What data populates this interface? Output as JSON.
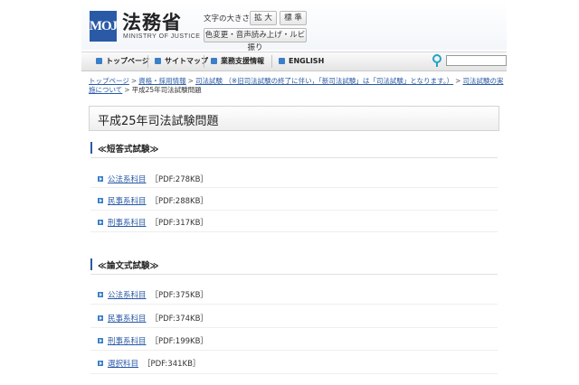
{
  "header": {
    "logo_mark": "MOJ",
    "logo_title": "法務省",
    "logo_sub": "MINISTRY OF JUSTICE",
    "textsize_label": "文字の大きさ",
    "btn_large": "拡 大",
    "btn_standard": "標 準",
    "btn_accessibility": "色変更・音声読み上げ・ルビ振り"
  },
  "nav": {
    "items": [
      {
        "label": "トップページ",
        "icon": "home-icon"
      },
      {
        "label": "サイトマップ",
        "icon": "sitemap-icon"
      },
      {
        "label": "業務支援情報",
        "icon": "support-icon"
      },
      {
        "label": "ENGLISH",
        "icon": "globe-icon"
      }
    ],
    "search_placeholder": ""
  },
  "breadcrumb": {
    "links": [
      "トップページ",
      "資格・採用情報",
      "司法試験 （※旧司法試験の終了に伴い，「新司法試験」は「司法試験」となります。）",
      "司法試験の実施について"
    ],
    "current": "平成25年司法試験問題"
  },
  "page_title": "平成25年司法試験問題",
  "sections": [
    {
      "title": "≪短答式試験≫",
      "items": [
        {
          "label": "公法系科目",
          "size": "［PDF:278KB］"
        },
        {
          "label": "民事系科目",
          "size": "［PDF:288KB］"
        },
        {
          "label": "刑事系科目",
          "size": "［PDF:317KB］"
        }
      ]
    },
    {
      "title": "≪論文式試験≫",
      "items": [
        {
          "label": "公法系科目",
          "size": "［PDF:375KB］"
        },
        {
          "label": "民事系科目",
          "size": "［PDF:374KB］"
        },
        {
          "label": "刑事系科目",
          "size": "［PDF:199KB］"
        },
        {
          "label": "選択科目",
          "size": "［PDF:341KB］"
        }
      ]
    }
  ],
  "colors": {
    "accent": "#2a5aa6",
    "nav_icon": "#3a7fc7",
    "search_icon": "#22a3c8"
  }
}
